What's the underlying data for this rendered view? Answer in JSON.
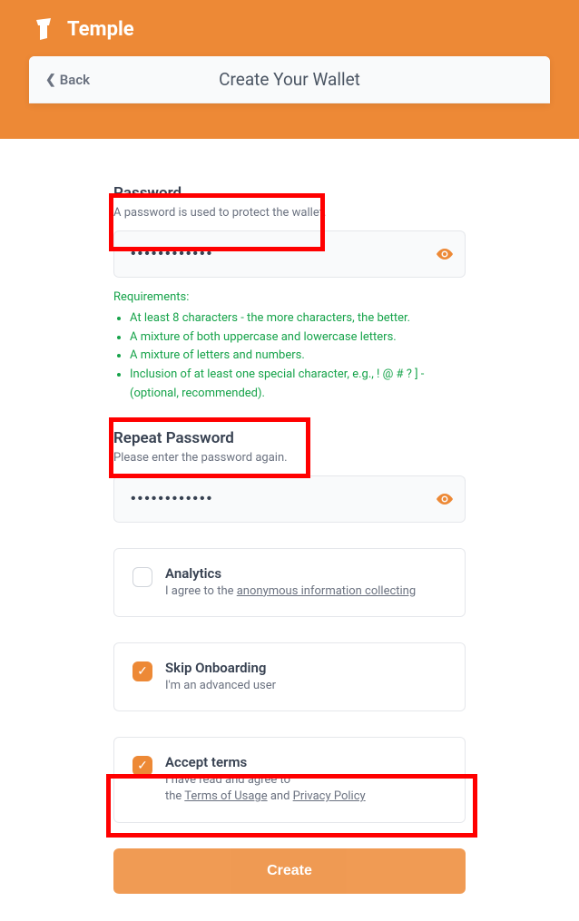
{
  "brand": "Temple",
  "back_label": "Back",
  "page_title": "Create Your Wallet",
  "password": {
    "label": "Password",
    "sublabel": "A password is used to protect the wallet.",
    "value": "••••••••••••",
    "requirements_title": "Requirements:",
    "requirements": [
      "At least 8 characters - the more characters, the better.",
      "A mixture of both uppercase and lowercase letters.",
      "A mixture of letters and numbers.",
      "Inclusion of at least one special character, e.g., ! @ # ? ] - (optional, recommended)."
    ]
  },
  "repeat_password": {
    "label": "Repeat Password",
    "sublabel": "Please enter the password again.",
    "value": "••••••••••••"
  },
  "analytics": {
    "title": "Analytics",
    "desc_prefix": "I agree to the ",
    "link": "anonymous information collecting",
    "checked": false
  },
  "skip_onboarding": {
    "title": "Skip Onboarding",
    "desc": "I'm an advanced user",
    "checked": true
  },
  "accept_terms": {
    "title": "Accept terms",
    "desc_prefix": "I have read and agree to",
    "the_word": "the ",
    "link1": "Terms of Usage",
    "and_word": " and ",
    "link2": "Privacy Policy",
    "checked": true
  },
  "create_label": "Create"
}
